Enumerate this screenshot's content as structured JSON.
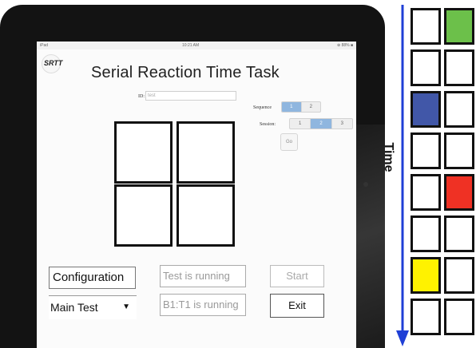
{
  "app": {
    "status_bar": {
      "carrier": "iPad",
      "time": "10:21 AM",
      "battery": "⊕ 88% ■"
    },
    "logo_text": "SRTT",
    "title": "Serial Reaction Time Task",
    "id_field": {
      "label": "ID:",
      "value": "test"
    },
    "sequence": {
      "label": "Sequence",
      "options": [
        "1",
        "2"
      ],
      "selected": 0
    },
    "session": {
      "label": "Session:",
      "options": [
        "1",
        "2",
        "3"
      ],
      "selected": 1
    },
    "go_button": "Go",
    "buttons": {
      "configuration": "Configuration",
      "start": "Start",
      "exit": "Exit"
    },
    "mode_select": {
      "value": "Main Test",
      "arrow": "▼"
    },
    "status": {
      "line1": "Test is running",
      "line2": "B1:T1 is running"
    }
  },
  "timeline": {
    "label": "Time",
    "arrow_color": "#1f3fd6",
    "steps": [
      {
        "left": "#ffffff",
        "right": "#6cc04a"
      },
      {
        "left": "#ffffff",
        "right": "#ffffff"
      },
      {
        "left": "#4157a8",
        "right": "#ffffff"
      },
      {
        "left": "#ffffff",
        "right": "#ffffff"
      },
      {
        "left": "#ffffff",
        "right": "#ef3124"
      },
      {
        "left": "#ffffff",
        "right": "#ffffff"
      },
      {
        "left": "#fff200",
        "right": "#ffffff"
      },
      {
        "left": "#ffffff",
        "right": "#ffffff"
      }
    ]
  }
}
